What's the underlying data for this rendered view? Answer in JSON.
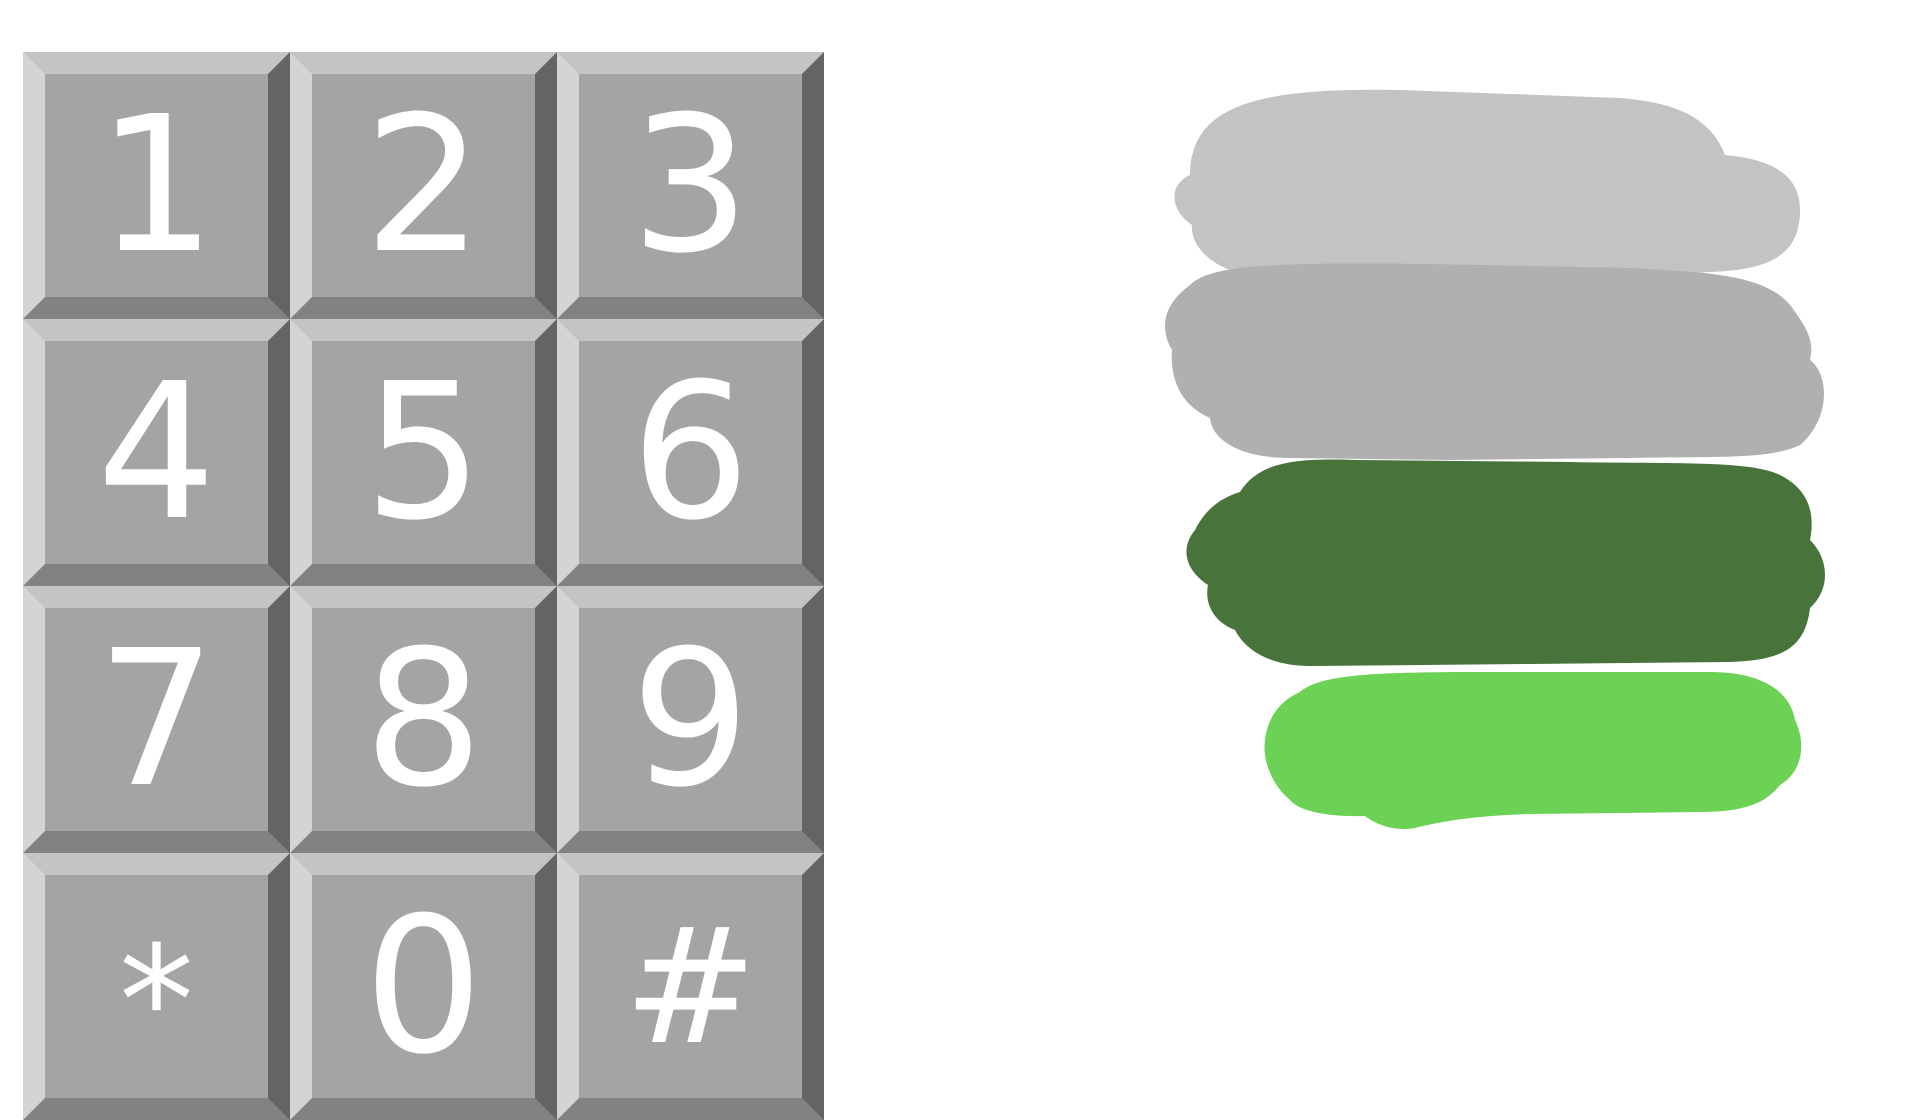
{
  "keypad": {
    "keys": [
      {
        "label": "1"
      },
      {
        "label": "2"
      },
      {
        "label": "3"
      },
      {
        "label": "4"
      },
      {
        "label": "5"
      },
      {
        "label": "6"
      },
      {
        "label": "7"
      },
      {
        "label": "8"
      },
      {
        "label": "9"
      },
      {
        "label": "*"
      },
      {
        "label": "0"
      },
      {
        "label": "#"
      }
    ],
    "colors": {
      "face": "#a4a4a4",
      "bevel_light": "#d4d4d4",
      "bevel_top": "#c4c4c4",
      "bevel_dark": "#646464",
      "bevel_bottom": "#828282",
      "label": "#ffffff"
    }
  },
  "swatches": [
    {
      "name": "light-gray-swatch",
      "color": "#c3c3c3"
    },
    {
      "name": "gray-swatch",
      "color": "#b0b0b0"
    },
    {
      "name": "dark-green-swatch",
      "color": "#48743c"
    },
    {
      "name": "light-green-swatch",
      "color": "#6cd255"
    }
  ]
}
